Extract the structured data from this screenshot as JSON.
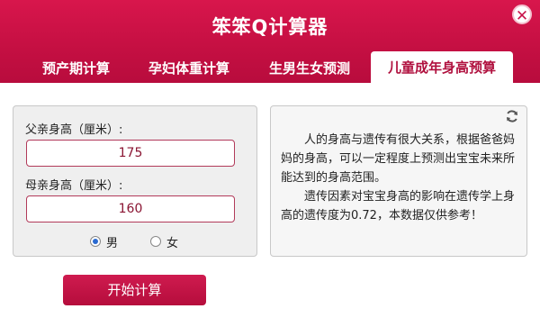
{
  "app": {
    "title": "笨笨Q计算器"
  },
  "tabs": [
    {
      "label": "预产期计算"
    },
    {
      "label": "孕妇体重计算"
    },
    {
      "label": "生男生女预测"
    },
    {
      "label": "儿童成年身高预算"
    }
  ],
  "form": {
    "father_label": "父亲身高（厘米）:",
    "father_value": "175",
    "mother_label": "母亲身高（厘米）:",
    "mother_value": "160",
    "gender_options": [
      {
        "label": "男",
        "selected": true
      },
      {
        "label": "女",
        "selected": false
      }
    ],
    "submit_label": "开始计算"
  },
  "info": {
    "paragraph1": "人的身高与遗传有很大关系，根据爸爸妈妈的身高，可以一定程度上预测出宝宝未来所能达到的身高范围。",
    "paragraph2": "遗传因素对宝宝身高的影响在遗传学上身高的遗传度为0.72，本数据仅供参考！"
  },
  "icons": {
    "close": "close-icon",
    "refresh": "refresh-icon"
  },
  "colors": {
    "brand": "#c8134a",
    "active_tab_text": "#b0103e",
    "input_border": "#b23a5a",
    "radio_selected": "#2a6ad0"
  }
}
